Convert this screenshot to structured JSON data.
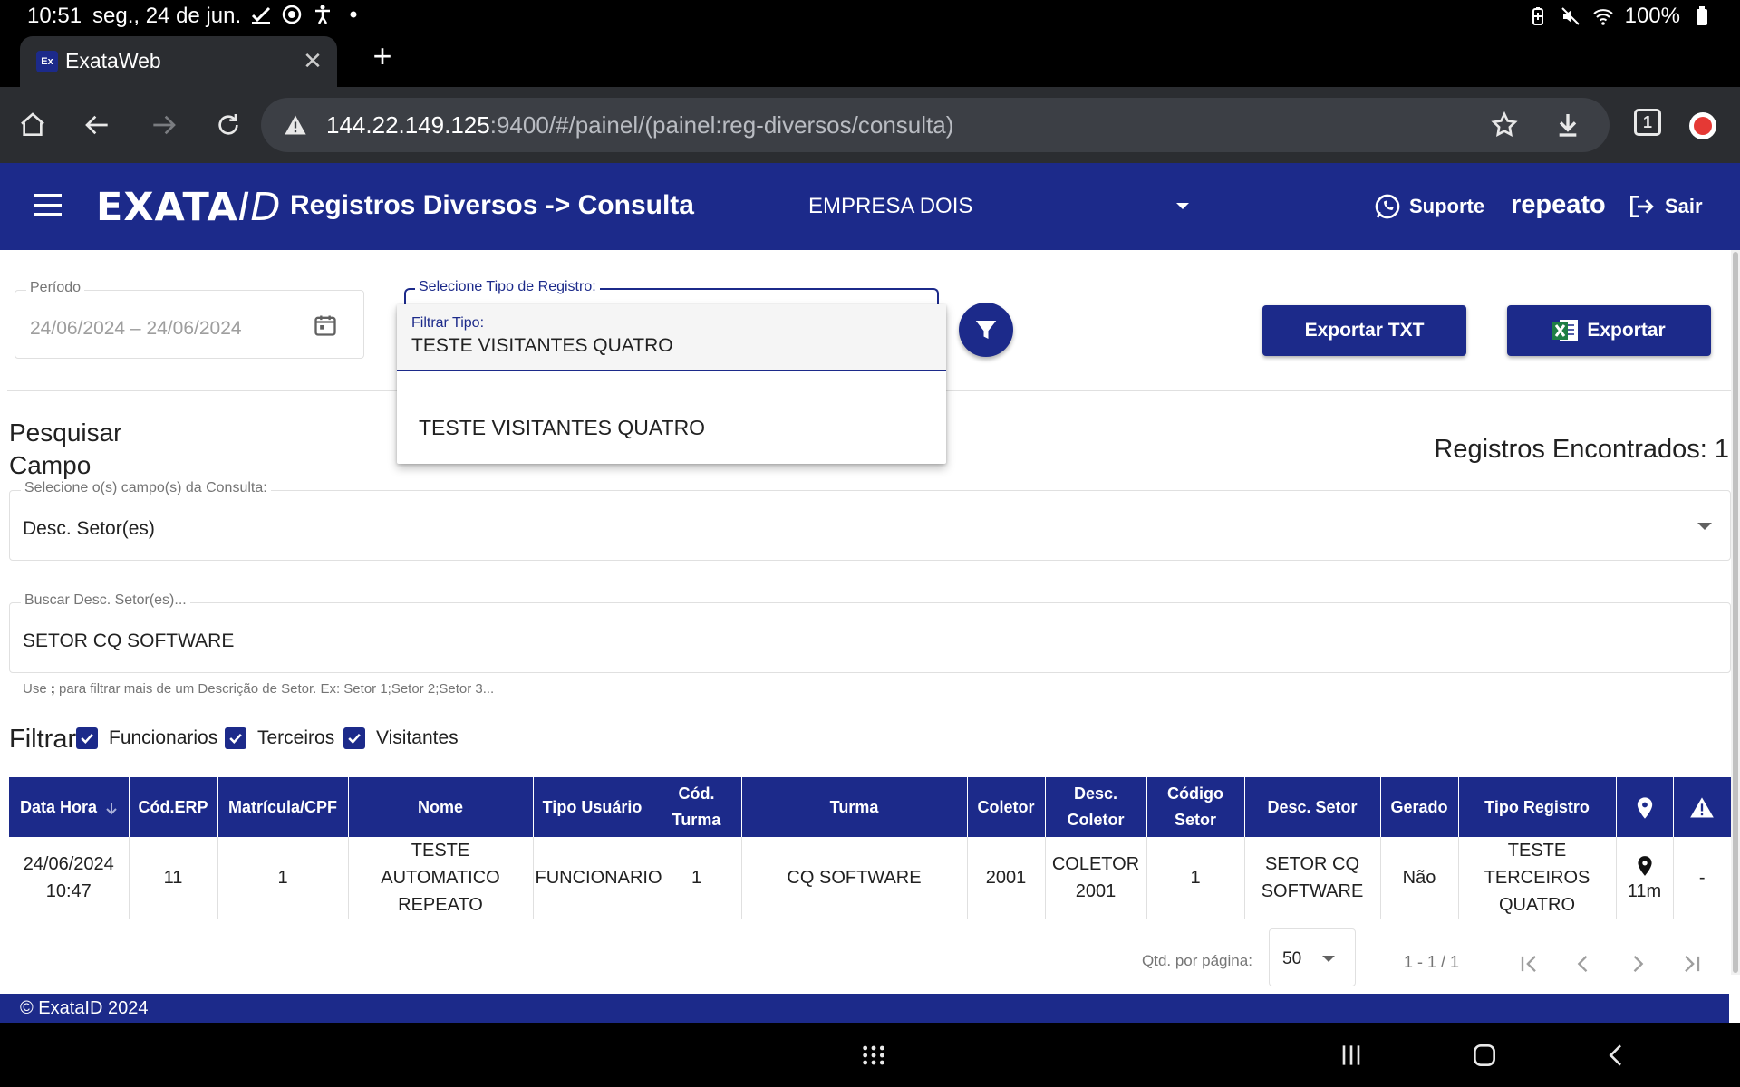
{
  "status_bar": {
    "time": "10:51",
    "date": "seg., 24 de jun.",
    "battery": "100%",
    "icons": [
      "check-icon",
      "circle-icon",
      "accessibility-icon",
      "dot-icon"
    ]
  },
  "browser": {
    "tab_title": "ExataWeb",
    "favicon_text": "Ex",
    "url_host": "144.22.149.125",
    "url_path": ":9400/#/painel/(painel:reg-diversos/consulta)",
    "tab_count": "1"
  },
  "header": {
    "logo_main": "EXATA",
    "logo_suffix": "ID",
    "title": "Registros Diversos -> Consulta",
    "company": "EMPRESA DOIS",
    "support_label": "Suporte",
    "username": "repeato",
    "logout_label": "Sair",
    "color": "#1c2a8a"
  },
  "filters": {
    "periodo_label": "Período",
    "periodo_value": "24/06/2024 – 24/06/2024",
    "tipo_label": "Selecione Tipo de Registro:",
    "export_txt_label": "Exportar TXT",
    "export_label": "Exportar"
  },
  "dropdown": {
    "filter_label": "Filtrar Tipo:",
    "filter_value": "TESTE VISITANTES QUATRO",
    "options": [
      "TESTE VISITANTES QUATRO"
    ]
  },
  "search": {
    "title": "Pesquisar Campo",
    "records_found": "Registros Encontrados: 1",
    "field_label": "Selecione o(s) campo(s) da Consulta:",
    "field_value": "Desc. Setor(es)",
    "search_label": "Buscar Desc. Setor(es)...",
    "search_value": "SETOR CQ SOFTWARE",
    "hint_prefix": "Use ",
    "hint_bold": ";",
    "hint_suffix": " para filtrar mais de um Descrição de Setor. Ex: Setor 1;Setor 2;Setor 3..."
  },
  "filter_checks": {
    "label": "Filtrar",
    "items": [
      {
        "label": "Funcionarios",
        "checked": true
      },
      {
        "label": "Terceiros",
        "checked": true
      },
      {
        "label": "Visitantes",
        "checked": true
      }
    ]
  },
  "table": {
    "columns": [
      "Data Hora",
      "Cód.ERP",
      "Matrícula/CPF",
      "Nome",
      "Tipo Usuário",
      "Cód. Turma",
      "Turma",
      "Coletor",
      "Desc. Coletor",
      "Código Setor",
      "Desc. Setor",
      "Gerado",
      "Tipo Registro",
      "location-icon",
      "warning-icon"
    ],
    "rows": [
      {
        "data_hora": "24/06/2024 10:47",
        "cod_erp": "11",
        "matricula": "1",
        "nome": "TESTE AUTOMATICO REPEATO",
        "tipo_usuario": "FUNCIONARIO",
        "cod_turma": "1",
        "turma": "CQ SOFTWARE",
        "coletor": "2001",
        "desc_coletor": "COLETOR 2001",
        "codigo_setor": "1",
        "desc_setor": "SETOR CQ SOFTWARE",
        "gerado": "Não",
        "tipo_registro": "TESTE TERCEIROS QUATRO",
        "distance": "11m",
        "alert": "-"
      }
    ]
  },
  "paginator": {
    "per_page_label": "Qtd. por página:",
    "per_page_value": "50",
    "range": "1 - 1 / 1"
  },
  "footer": {
    "text": "© ExataID 2024"
  }
}
